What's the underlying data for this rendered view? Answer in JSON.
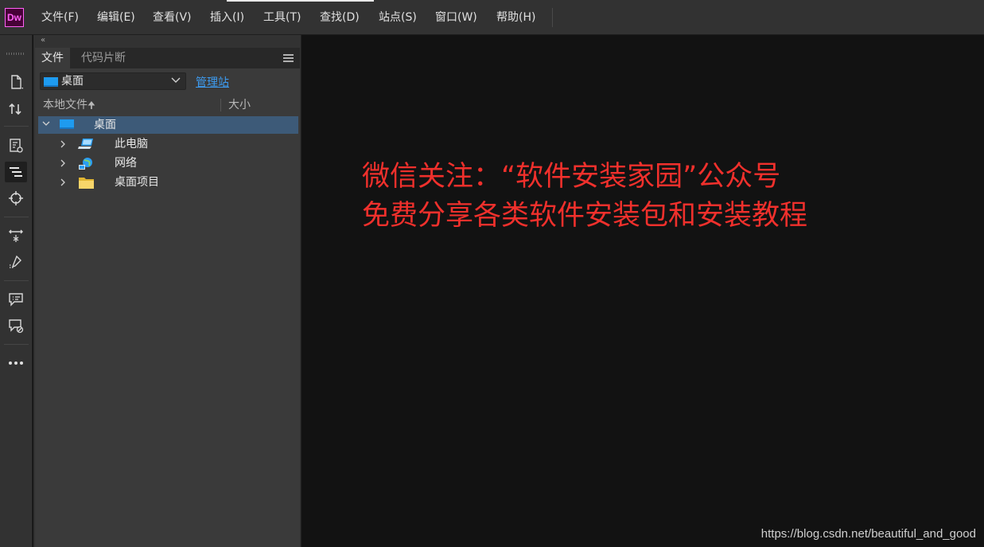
{
  "app": {
    "logo_text": "Dw",
    "brand_color": "#470137",
    "accent_color": "#ff61f6"
  },
  "menu": [
    {
      "label": "文件(F)"
    },
    {
      "label": "编辑(E)"
    },
    {
      "label": "查看(V)"
    },
    {
      "label": "插入(I)"
    },
    {
      "label": "工具(T)"
    },
    {
      "label": "查找(D)"
    },
    {
      "label": "站点(S)"
    },
    {
      "label": "窗口(W)"
    },
    {
      "label": "帮助(H)"
    }
  ],
  "toolbar": {
    "icons": [
      "new-document-icon",
      "file-transfer-icon",
      "live-view-inspect-icon",
      "dom-panel-icon",
      "target-icon",
      "element-transform-icon",
      "code-hint-icon",
      "comment-icon",
      "comment-remove-icon",
      "more-icon"
    ]
  },
  "panel": {
    "collapse_glyph": "«",
    "tabs": [
      {
        "label": "文件"
      },
      {
        "label": "代码片断"
      }
    ],
    "site_select": {
      "value": "桌面"
    },
    "manage_link": "管理站",
    "columns": {
      "local_files": "本地文件",
      "sort_glyph": "🠉",
      "size": "大小"
    },
    "tree": [
      {
        "label": "桌面",
        "icon": "monitor-icon",
        "expanded": true
      },
      {
        "label": "此电脑",
        "icon": "computer-icon"
      },
      {
        "label": "网络",
        "icon": "network-icon"
      },
      {
        "label": "桌面项目",
        "icon": "folder-icon"
      }
    ]
  },
  "document": {
    "promo_line1": "微信关注：“软件安装家园”公众号",
    "promo_line2": "免费分享各类软件安装包和安装教程",
    "promo_color": "#f0302c",
    "watermark": "https://blog.csdn.net/beautiful_and_good"
  }
}
